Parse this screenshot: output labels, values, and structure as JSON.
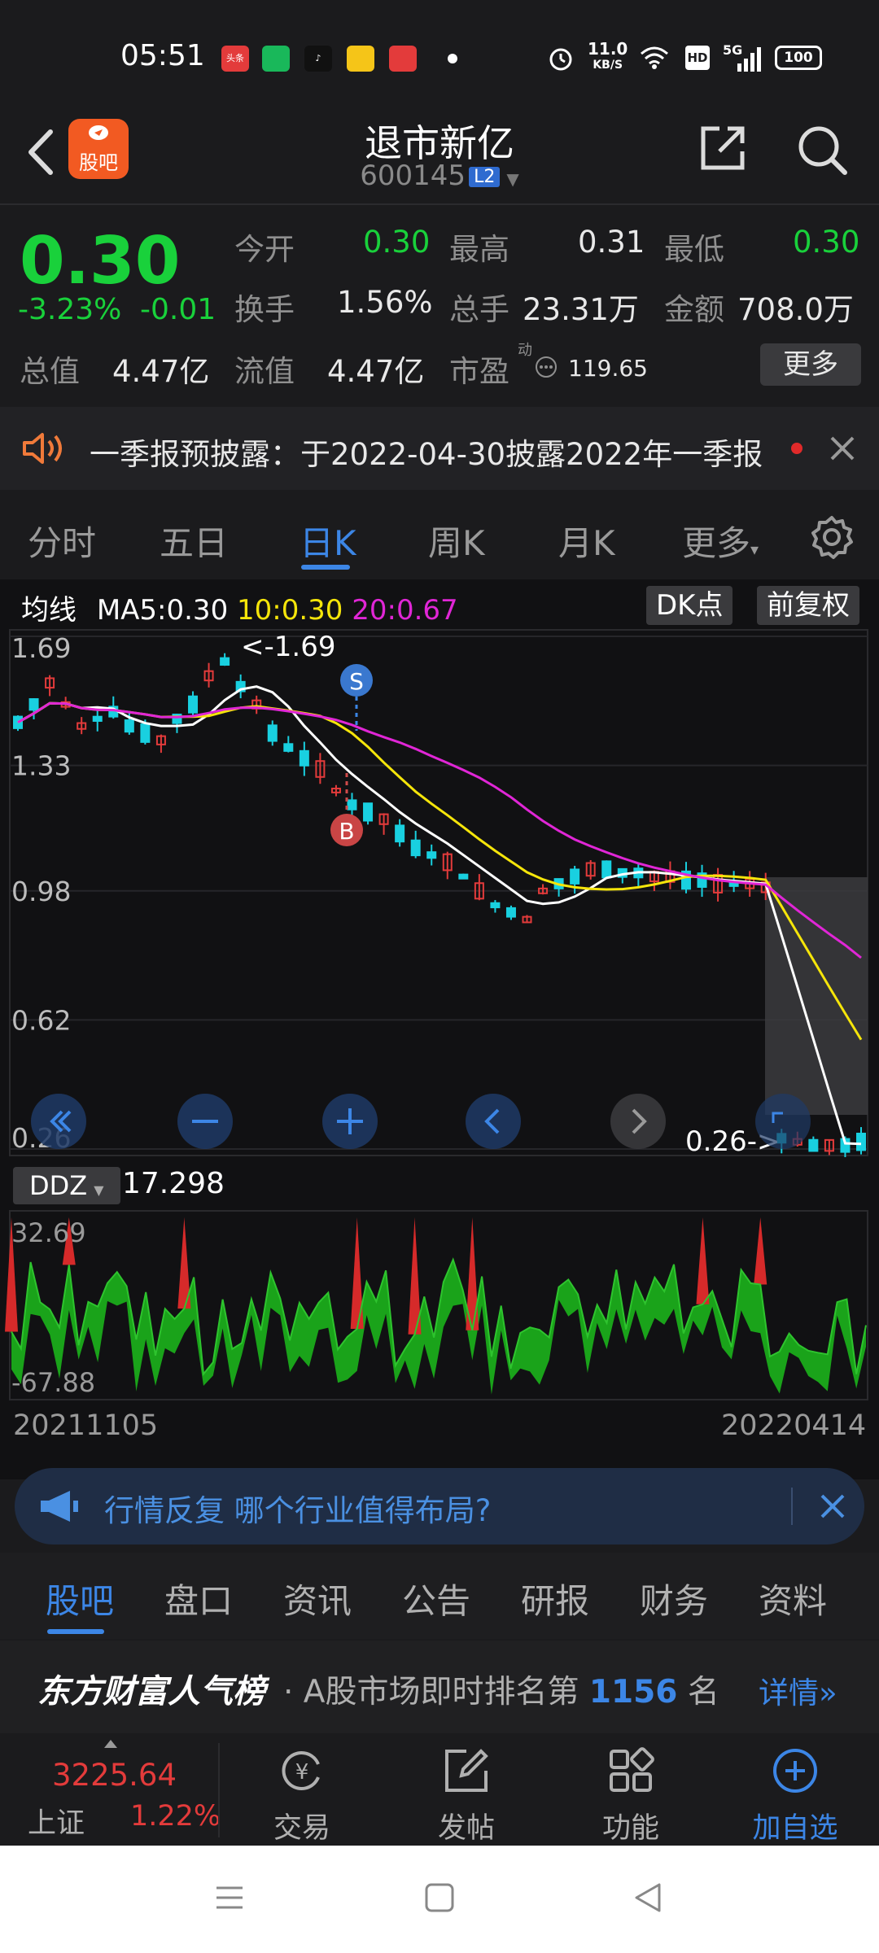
{
  "status_bar": {
    "time": "05:51",
    "app_icons": [
      "头条",
      "",
      "",
      "",
      ""
    ],
    "speed_top": "11.0",
    "speed_bottom": "KB/S",
    "hd": "HD",
    "network": "5G",
    "battery": "100"
  },
  "header": {
    "logo_label": "股吧",
    "title": "退市新亿",
    "code": "600145",
    "level_badge": "L2"
  },
  "quote": {
    "price": "0.30",
    "change_pct": "-3.23%",
    "change": "-0.01",
    "fields": {
      "open_label": "今开",
      "open": "0.30",
      "high_label": "最高",
      "high": "0.31",
      "low_label": "最低",
      "low": "0.30",
      "turnover_label": "换手",
      "turnover": "1.56%",
      "volume_label": "总手",
      "volume": "23.31万",
      "amount_label": "金额",
      "amount": "708.0万",
      "total_cap_label": "总值",
      "total_cap": "4.47亿",
      "float_cap_label": "流值",
      "float_cap": "4.47亿",
      "pe_label": "市盈",
      "pe_sup": "动",
      "pe": "119.65"
    },
    "more_button": "更多"
  },
  "notice": {
    "text": "一季报预披露：于2022-04-30披露2022年一季报"
  },
  "period_tabs": {
    "items": [
      "分时",
      "五日",
      "日K",
      "周K",
      "月K",
      "更多"
    ],
    "active_index": 2
  },
  "chart_header": {
    "ma_label": "均线",
    "ma5": "MA5:0.30",
    "ma10": "10:0.30",
    "ma20": "20:0.67",
    "dk_button": "DK点",
    "adjust_button": "前复权"
  },
  "chart_data": {
    "type": "candlestick",
    "y_ticks": [
      "1.69",
      "1.33",
      "0.98",
      "0.62",
      "0.26"
    ],
    "ylim": [
      0.26,
      1.69
    ],
    "high_marker": "<-1.69",
    "low_marker": "0.26->",
    "signals": [
      "S",
      "B"
    ],
    "colors": {
      "up": "#e33b3b",
      "down": "#19d0e0",
      "ma5": "#ffffff",
      "ma10": "#f5e50a",
      "ma20": "#e026d6"
    }
  },
  "indicator": {
    "name": "DDZ",
    "value": "17.298",
    "y_top": "32.69",
    "y_bottom": "-67.88"
  },
  "dates": {
    "start": "20211105",
    "end": "20220414"
  },
  "promo": {
    "text": "行情反复 哪个行业值得布局?"
  },
  "bottom_tabs": {
    "items": [
      "股吧",
      "盘口",
      "资讯",
      "公告",
      "研报",
      "财务",
      "资料"
    ],
    "active_index": 0
  },
  "rank": {
    "brand": "东方财富人气榜",
    "text_before": "· A股市场即时排名第",
    "number": "1156",
    "text_after": "名",
    "detail": "详情"
  },
  "bottom_nav": {
    "index_value": "3225.64",
    "index_name": "上证",
    "index_pct": "1.22%",
    "items": [
      "交易",
      "发帖",
      "功能",
      "加自选"
    ]
  }
}
